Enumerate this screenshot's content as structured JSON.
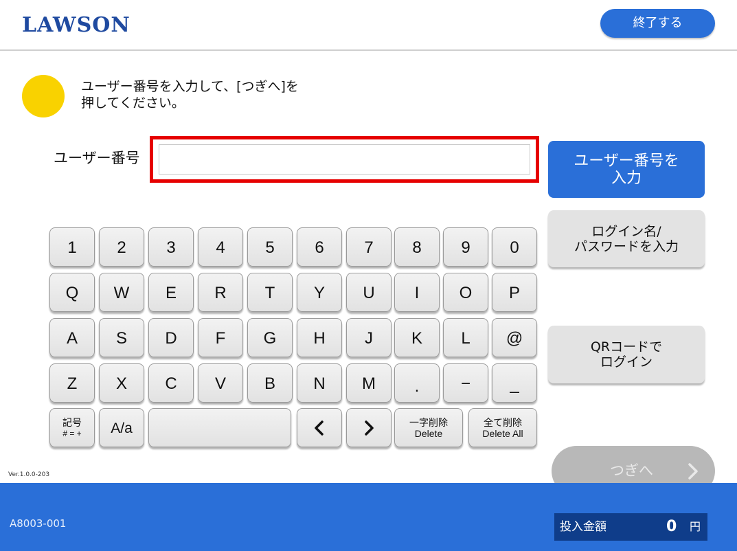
{
  "header": {
    "logo_text": "LAWSON",
    "exit_label": "終了する"
  },
  "instruction": {
    "line1": "ユーザー番号を入力して、[つぎへ]を",
    "line2": "押してください。"
  },
  "user_field": {
    "label": "ユーザー番号",
    "value": ""
  },
  "side_buttons": {
    "user_number_line1": "ユーザー番号を",
    "user_number_line2": "入力",
    "login_name_line1": "ログイン名/",
    "login_name_line2": "パスワードを入力",
    "qr_line1": "QRコードで",
    "qr_line2": "ログイン"
  },
  "next": {
    "label": "つぎへ"
  },
  "keyboard": {
    "row1": [
      "1",
      "2",
      "3",
      "4",
      "5",
      "6",
      "7",
      "8",
      "9",
      "0"
    ],
    "row2": [
      "Q",
      "W",
      "E",
      "R",
      "T",
      "Y",
      "U",
      "I",
      "O",
      "P"
    ],
    "row3": [
      "A",
      "S",
      "D",
      "F",
      "G",
      "H",
      "J",
      "K",
      "L",
      "@"
    ],
    "row4": [
      "Z",
      "X",
      "C",
      "V",
      "B",
      "N",
      "M",
      ".",
      "−",
      "_"
    ],
    "symbol_line1": "記号",
    "symbol_line2": "# = +",
    "case_toggle": "A/a",
    "delete_line1": "一字削除",
    "delete_line2": "Delete",
    "delete_all_line1": "全て削除",
    "delete_all_line2": "Delete All"
  },
  "footer": {
    "version": "Ver.1.0.0-203",
    "screen_id": "A8003-001",
    "amount_label": "投入金額",
    "amount_value": "0",
    "amount_unit": "円"
  },
  "colors": {
    "brand_blue": "#2a6fd8",
    "logo_blue": "#1f4aa0",
    "highlight_red": "#e60000",
    "info_yellow": "#f9d200",
    "disabled_gray": "#b8b8b8"
  }
}
